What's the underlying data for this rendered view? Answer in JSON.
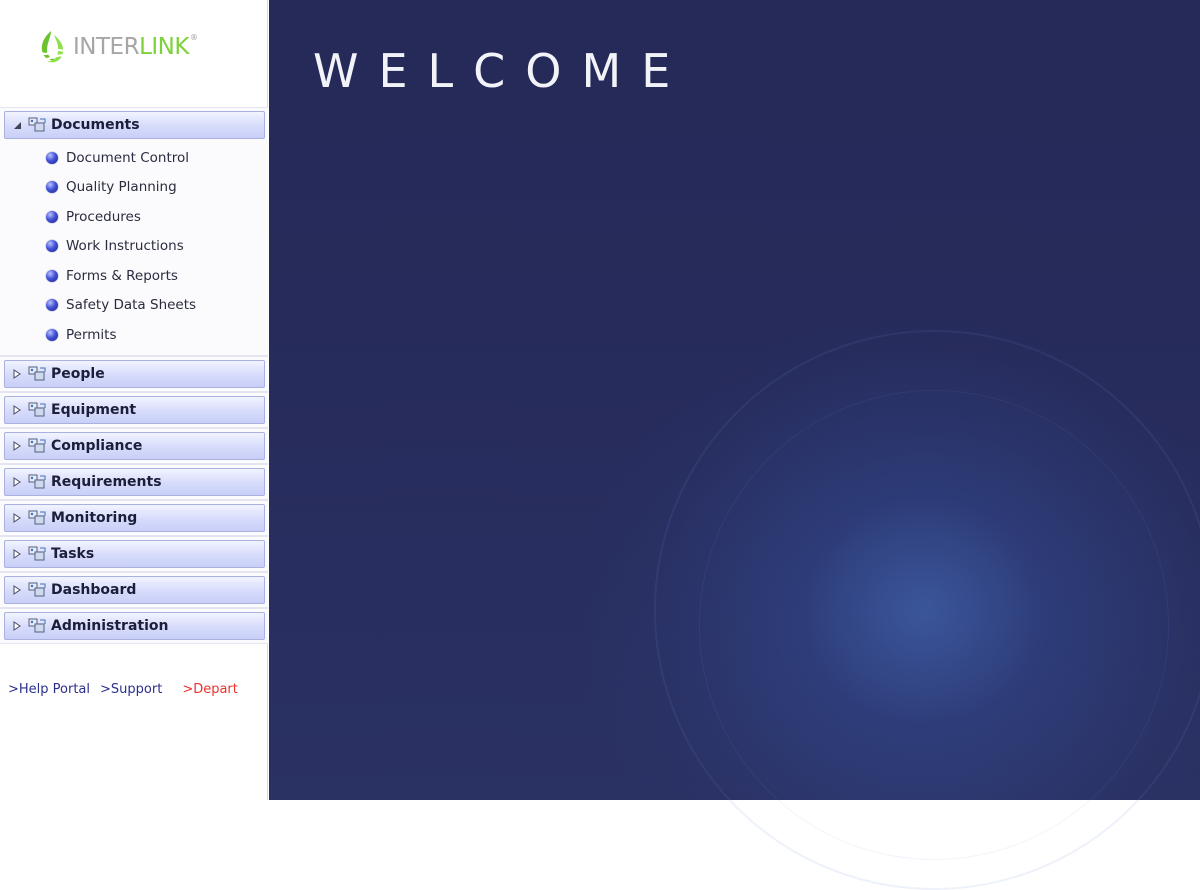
{
  "logo": {
    "inter": "INTER",
    "link": "LINK",
    "reg": "®"
  },
  "nav": {
    "groups": [
      {
        "label": "Documents",
        "expanded": true,
        "items": [
          "Document Control",
          "Quality Planning",
          "Procedures",
          "Work Instructions",
          "Forms & Reports",
          "Safety Data Sheets",
          "Permits"
        ]
      },
      {
        "label": "People",
        "expanded": false
      },
      {
        "label": "Equipment",
        "expanded": false
      },
      {
        "label": "Compliance",
        "expanded": false
      },
      {
        "label": "Requirements",
        "expanded": false
      },
      {
        "label": "Monitoring",
        "expanded": false
      },
      {
        "label": "Tasks",
        "expanded": false
      },
      {
        "label": "Dashboard",
        "expanded": false
      },
      {
        "label": "Administration",
        "expanded": false
      }
    ]
  },
  "links": {
    "help": ">Help Portal",
    "support": ">Support",
    "depart": ">Depart"
  },
  "main": {
    "welcome": "WELCOME"
  },
  "colors": {
    "header_bg": "#d6dbfb",
    "main_bg": "#262a58",
    "brand_green": "#7dd13a",
    "depart_red": "#e8322b"
  },
  "icons": {
    "group": "modules-icon",
    "expanded": "triangle-down-icon",
    "collapsed": "triangle-right-icon",
    "item": "blue-orb-icon"
  }
}
